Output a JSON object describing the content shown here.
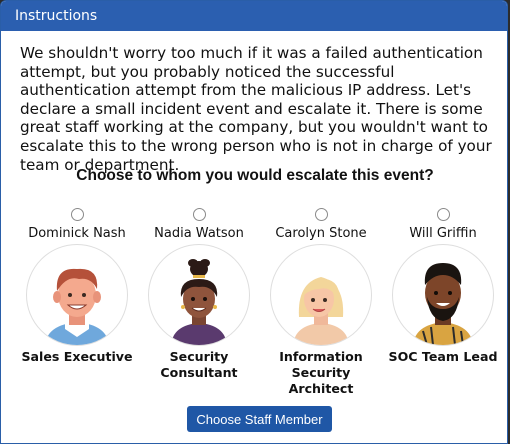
{
  "window": {
    "title": "Instructions"
  },
  "body": {
    "text": "We shouldn't worry too much if it was a failed authentication attempt, but you probably noticed the successful authentication attempt from the malicious IP address. Let's declare a small incident event and escalate it. There is some great staff working at the company, but you wouldn't want to escalate this to the wrong person who is not in charge of your team or department."
  },
  "question": "Choose to whom you would escalate this event?",
  "staff": [
    {
      "name": "Dominick Nash",
      "role": "Sales Executive"
    },
    {
      "name": "Nadia Watson",
      "role": "Security Consultant"
    },
    {
      "name": "Carolyn Stone",
      "role": "Information Security Architect"
    },
    {
      "name": "Will Griffin",
      "role": "SOC Team Lead"
    }
  ],
  "button": {
    "label": "Choose Staff Member"
  },
  "colors": {
    "titlebar": "#2b5fb0",
    "button": "#1f57a6",
    "background": "#ffffff"
  }
}
